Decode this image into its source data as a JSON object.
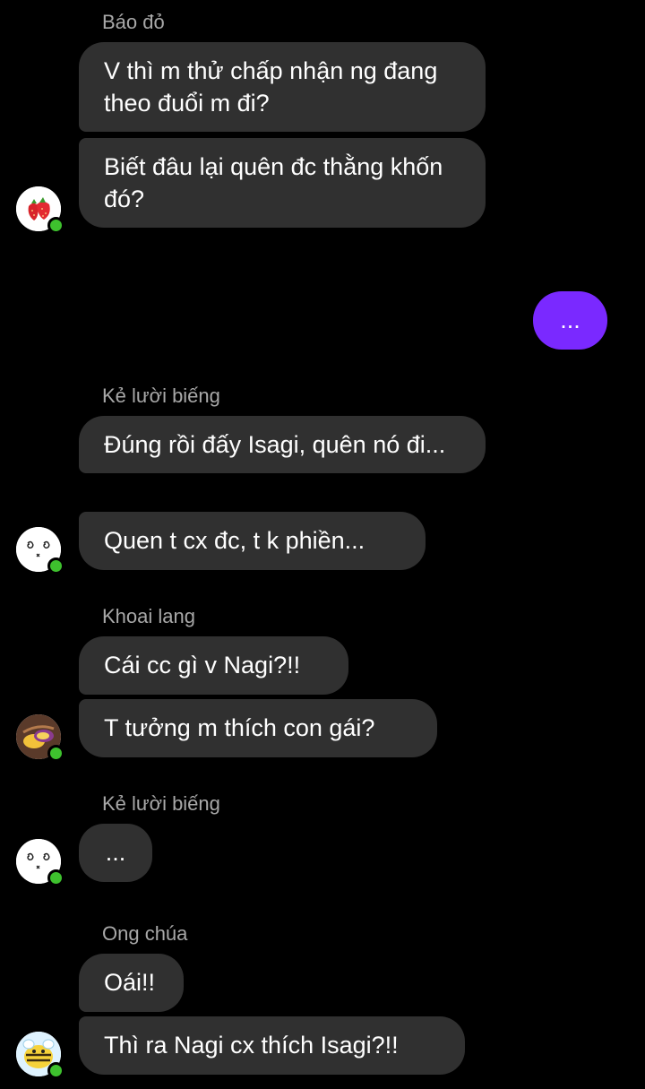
{
  "colors": {
    "background": "#000000",
    "incoming_bubble": "#303030",
    "outgoing_bubble": "#7a29ff",
    "sender_name": "#a8a8a8",
    "online_indicator": "#3ec12e"
  },
  "conversation": [
    {
      "sender": "Báo đỏ",
      "avatar_icon": "strawberry-avatar",
      "messages": [
        "V thì m thử chấp nhận ng đang theo đuổi m đi?",
        "Biết đâu lại quên đc thằng khốn đó?"
      ]
    },
    {
      "sender": "",
      "outgoing": true,
      "messages": [
        "..."
      ]
    },
    {
      "sender": "Kẻ lười biếng",
      "avatar_icon": "dizzy-face-avatar",
      "messages": [
        "Đúng rồi đấy Isagi, quên nó đi...",
        "Quen t cx đc, t k phiền..."
      ]
    },
    {
      "sender": "Khoai lang",
      "avatar_icon": "sweet-potato-avatar",
      "messages": [
        "Cái cc gì v Nagi?!!",
        "T tưởng m thích con gái?"
      ]
    },
    {
      "sender": "Kẻ lười biếng",
      "avatar_icon": "dizzy-face-avatar",
      "messages": [
        "..."
      ]
    },
    {
      "sender": "Ong chúa",
      "avatar_icon": "bee-avatar",
      "messages": [
        "Oái!!",
        "Thì ra Nagi cx thích Isagi?!!"
      ]
    }
  ]
}
